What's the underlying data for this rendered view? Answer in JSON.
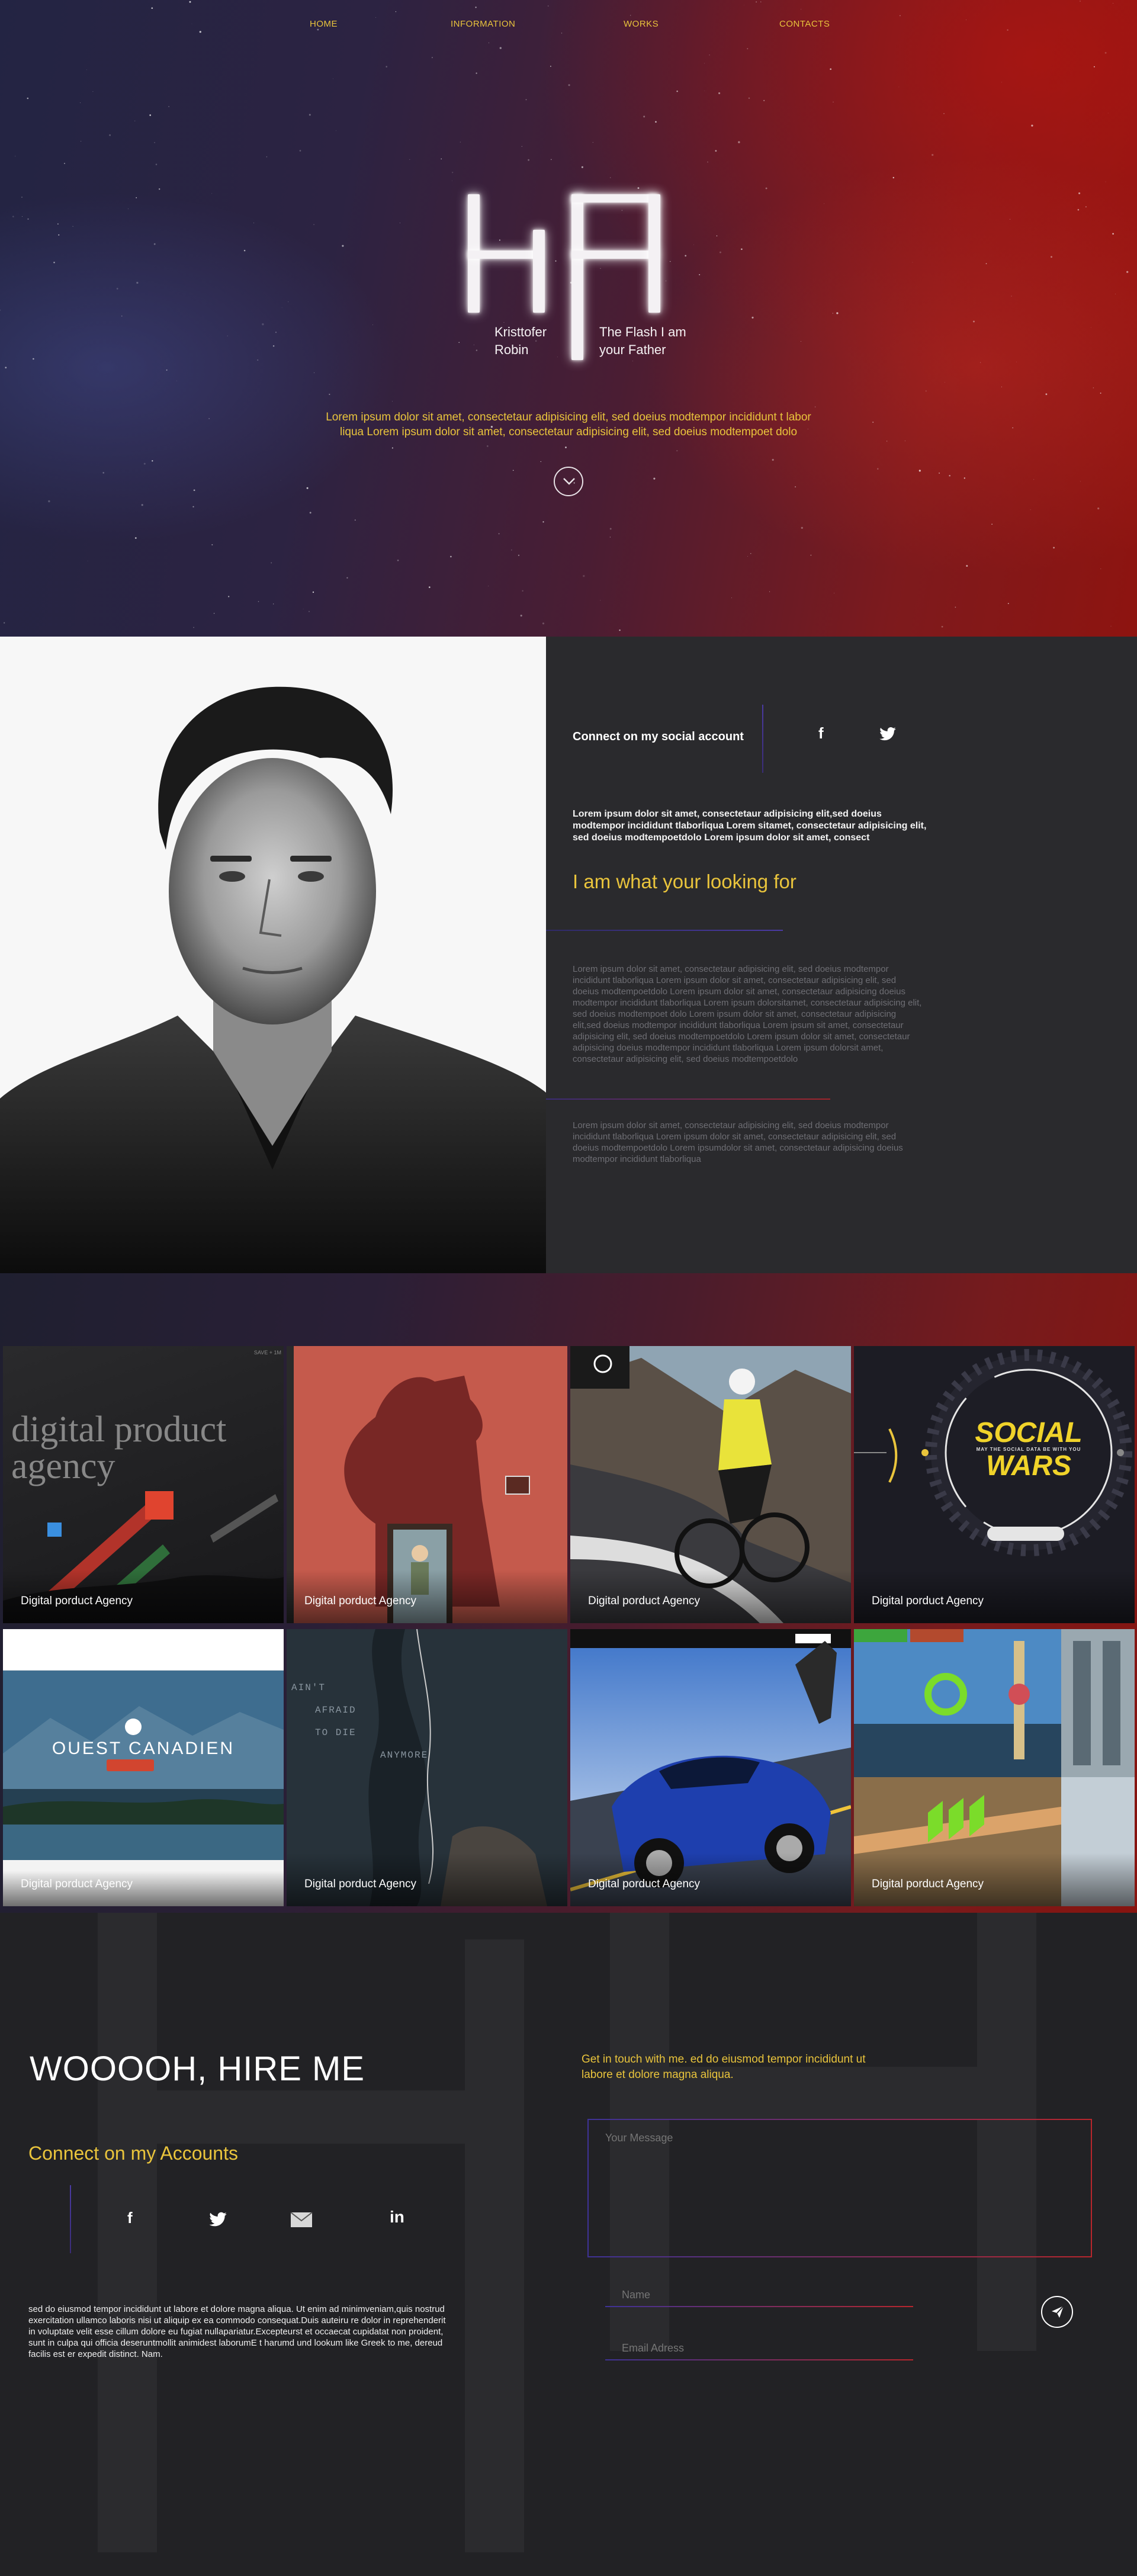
{
  "nav": {
    "items": [
      {
        "label": "HOME"
      },
      {
        "label": "INFORMATION"
      },
      {
        "label": "WORKS"
      },
      {
        "label": "CONTACTS"
      }
    ]
  },
  "hero": {
    "logo_left_label": "Kristtofer Robin",
    "logo_right_label": "The Flash I am your Father",
    "text_line1": "Lorem ipsum dolor sit amet, consectetaur adipisicing elit, sed doeius modtempor incididunt t labor",
    "text_line2": "liqua Lorem ipsum dolor sit amet, consectetaur adipisicing elit, sed doeius modtempoet dolo",
    "scroll_icon": "chevron-down-icon"
  },
  "about": {
    "social_label": "Connect on my social account",
    "social_icons": [
      "facebook-icon",
      "twitter-icon"
    ],
    "bold_text": "Lorem ipsum dolor sit amet, consectetaur adipisicing elit,sed doeius modtempor incididunt tlaborliqua Lorem sitamet, consectetaur adipisicing elit, sed doeius modtempoetdolo Lorem ipsum dolor sit amet, consect",
    "tagline": "I am what your looking for",
    "para1": "Lorem ipsum dolor sit amet, consectetaur adipisicing elit, sed doeius modtempor incididunt tlaborliqua Lorem ipsum dolor sit amet, consectetaur adipisicing elit, sed doeius modtempoetdolo Lorem ipsum dolor sit amet, consectetaur adipisicing doeius modtempor incididunt tlaborliqua Lorem ipsum dolorsitamet, consectetaur adipisicing elit, sed doeius modtempoet dolo Lorem ipsum dolor sit amet, consectetaur adipisicing elit,sed doeius modtempor incididunt tlaborliqua Lorem ipsum sit amet, consectetaur adipisicing elit, sed doeius modtempoetdolo Lorem ipsum dolor sit amet, consectetaur adipisicing doeius modtempor incididunt tlaborliqua Lorem ipsum dolorsit amet, consectetaur adipisicing elit, sed doeius modtempoetdolo",
    "para2": "Lorem ipsum dolor sit amet, consectetaur adipisicing elit, sed doeius modtempor incididunt tlaborliqua Lorem ipsum dolor sit amet, consectetaur adipisicing elit, sed doeius modtempoetdolo Lorem ipsumdolor sit amet, consectetaur adipisicing doeius modtempor incididunt tlaborliqua"
  },
  "works": {
    "tiles": [
      {
        "caption": "Digital porduct Agency",
        "overlay": "digital product agency"
      },
      {
        "caption": "Digital porduct Agency"
      },
      {
        "caption": "Digital porduct Agency"
      },
      {
        "caption": "Digital porduct Agency",
        "overlay_top": "SOCIAL",
        "overlay_bottom": "WARS",
        "overlay_small": "MAY THE SOCIAL DATA BE WITH YOU"
      },
      {
        "caption": "Digital porduct Agency",
        "overlay": "OUEST CANADIEN"
      },
      {
        "caption": "Digital porduct Agency",
        "overlay_lines": [
          "AIN'T",
          "AFRAID",
          "TO DIE",
          "ANYMORE"
        ]
      },
      {
        "caption": "Digital porduct Agency"
      },
      {
        "caption": "Digital porduct Agency"
      }
    ]
  },
  "contact": {
    "hire_title": "WOOOOH, HIRE ME",
    "accounts_title": "Connect on my Accounts",
    "icons": [
      "facebook-icon",
      "twitter-icon",
      "mail-icon",
      "linkedin-icon"
    ],
    "paragraph": "sed do eiusmod tempor incididunt ut labore et dolore magna aliqua. Ut enim ad minimveniam,quis nostrud exercitation ullamco laboris nisi ut aliquip ex ea commodo consequat.Duis auteiru re dolor in reprehenderit in voluptate velit esse cillum dolore eu fugiat nullapariatur.Excepteurst et occaecat cupidatat non proident, sunt in culpa qui officia deseruntmollit animidest laborumE t harumd und lookum like Greek to me, dereud facilis est er expedit distinct. Nam.",
    "get_in_touch": "Get in touch with me. ed do eiusmod tempor incididunt ut labore et dolore magna aliqua.",
    "message_placeholder": "Your Message",
    "name_placeholder": "Name",
    "email_placeholder": "Email Adress",
    "send_icon": "send-icon"
  },
  "colors": {
    "accent": "#e9c43c",
    "dark_bg": "#222225",
    "panel_bg": "#2a2a2d",
    "line_blue": "#3e3296",
    "line_red": "#b7262c"
  }
}
